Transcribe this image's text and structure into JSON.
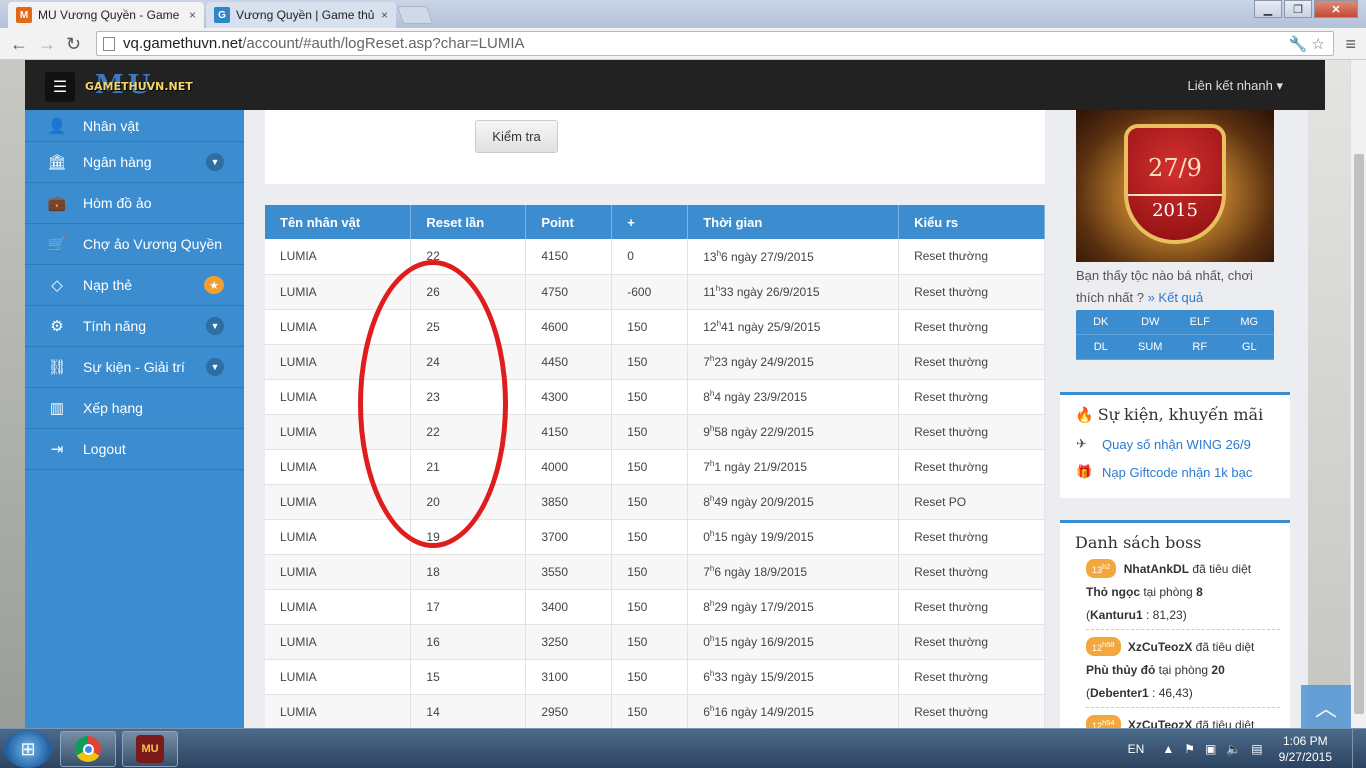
{
  "browser": {
    "tabs": [
      {
        "title": "MU Vương Quyền - Game",
        "favicon": "mu-favicon",
        "close": "×"
      },
      {
        "title": "Vương Quyền | Game thủ",
        "favicon": "g-favicon",
        "close": "×"
      }
    ],
    "url_host": "vq.gamethuvn.net",
    "url_path": "/account/#auth/logReset.asp?char=LUMIA"
  },
  "header": {
    "logo_mu": "MU",
    "logo_site": "GAMETHUVN.NET",
    "quick_link": "Liên kết nhanh"
  },
  "sidebar": {
    "items": [
      {
        "label": "Nhân vật",
        "icon": "user-icon"
      },
      {
        "label": "Ngân hàng",
        "icon": "bank-icon"
      },
      {
        "label": "Hòm đồ ảo",
        "icon": "briefcase-icon"
      },
      {
        "label": "Chợ ảo Vương Quyền",
        "icon": "cart-icon"
      },
      {
        "label": "Nạp thẻ",
        "icon": "diamond-icon"
      },
      {
        "label": "Tính năng",
        "icon": "gears-icon"
      },
      {
        "label": "Sự kiện - Giải trí",
        "icon": "link-icon"
      },
      {
        "label": "Xếp hạng",
        "icon": "bar-chart-icon"
      },
      {
        "label": "Logout",
        "icon": "logout-icon"
      }
    ]
  },
  "check_button": "Kiểm tra",
  "table": {
    "headers": [
      "Tên nhân vật",
      "Reset lần",
      "Point",
      "+",
      "Thời gian",
      "Kiểu rs"
    ],
    "rows": [
      {
        "name": "LUMIA",
        "reset": "22",
        "point": "4150",
        "plus": "0",
        "h": "13",
        "m": "6 ngày 27/9/2015",
        "type": "Reset thường"
      },
      {
        "name": "LUMIA",
        "reset": "26",
        "point": "4750",
        "plus": "-600",
        "h": "11",
        "m": "33 ngày 26/9/2015",
        "type": "Reset thường"
      },
      {
        "name": "LUMIA",
        "reset": "25",
        "point": "4600",
        "plus": "150",
        "h": "12",
        "m": "41 ngày 25/9/2015",
        "type": "Reset thường"
      },
      {
        "name": "LUMIA",
        "reset": "24",
        "point": "4450",
        "plus": "150",
        "h": "7",
        "m": "23 ngày 24/9/2015",
        "type": "Reset thường"
      },
      {
        "name": "LUMIA",
        "reset": "23",
        "point": "4300",
        "plus": "150",
        "h": "8",
        "m": "4 ngày 23/9/2015",
        "type": "Reset thường"
      },
      {
        "name": "LUMIA",
        "reset": "22",
        "point": "4150",
        "plus": "150",
        "h": "9",
        "m": "58 ngày 22/9/2015",
        "type": "Reset thường"
      },
      {
        "name": "LUMIA",
        "reset": "21",
        "point": "4000",
        "plus": "150",
        "h": "7",
        "m": "1 ngày 21/9/2015",
        "type": "Reset thường"
      },
      {
        "name": "LUMIA",
        "reset": "20",
        "point": "3850",
        "plus": "150",
        "h": "8",
        "m": "49 ngày 20/9/2015",
        "type": "Reset PO"
      },
      {
        "name": "LUMIA",
        "reset": "19",
        "point": "3700",
        "plus": "150",
        "h": "0",
        "m": "15 ngày 19/9/2015",
        "type": "Reset thường"
      },
      {
        "name": "LUMIA",
        "reset": "18",
        "point": "3550",
        "plus": "150",
        "h": "7",
        "m": "6 ngày 18/9/2015",
        "type": "Reset thường"
      },
      {
        "name": "LUMIA",
        "reset": "17",
        "point": "3400",
        "plus": "150",
        "h": "8",
        "m": "29 ngày 17/9/2015",
        "type": "Reset thường"
      },
      {
        "name": "LUMIA",
        "reset": "16",
        "point": "3250",
        "plus": "150",
        "h": "0",
        "m": "15 ngày 16/9/2015",
        "type": "Reset thường"
      },
      {
        "name": "LUMIA",
        "reset": "15",
        "point": "3100",
        "plus": "150",
        "h": "6",
        "m": "33 ngày 15/9/2015",
        "type": "Reset thường"
      },
      {
        "name": "LUMIA",
        "reset": "14",
        "point": "2950",
        "plus": "150",
        "h": "6",
        "m": "16 ngày 14/9/2015",
        "type": "Reset thường"
      }
    ]
  },
  "banner": {
    "date": "27/9",
    "year": "2015"
  },
  "vote": {
    "question": "Bạn thấy tộc nào bá nhất, chơi thích nhất ?",
    "link": "» Kết quả"
  },
  "classes": [
    "DK",
    "DW",
    "ELF",
    "MG",
    "DL",
    "SUM",
    "RF",
    "GL"
  ],
  "events": {
    "title": "Sự kiện, khuyến mãi",
    "items": [
      {
        "label": "Quay số nhận WING 26/9",
        "icon": "plane-icon"
      },
      {
        "label": "Nạp Giftcode nhận 1k bạc",
        "icon": "gift-icon"
      }
    ]
  },
  "boss": {
    "title": "Danh sách boss",
    "entries": [
      {
        "time_h": "13",
        "time_m": "h2",
        "killer": "NhatAnkDL",
        "verb": "đã tiêu diệt",
        "boss": "Thỏ ngọc",
        "room_label": "tại phòng",
        "room": "8",
        "map": "Kanturu1",
        "coords": ": 81,23)"
      },
      {
        "time_h": "12",
        "time_m": "h58",
        "killer": "XzCuTeozX",
        "verb": "đã tiêu diệt",
        "boss": "Phù thủy đỏ",
        "room_label": "tại phòng",
        "room": "20",
        "map": "Debenter1",
        "coords": ": 46,43)"
      },
      {
        "time_h": "12",
        "time_m": "h54",
        "killer": "XzCuTeozX",
        "verb": "đã tiêu diệt"
      }
    ]
  },
  "taskbar": {
    "lang": "EN",
    "time": "1:06 PM",
    "date": "9/27/2015",
    "mu_app_label": "MU"
  },
  "colors": {
    "accent": "#3c8dd0",
    "header": "#222222",
    "annotation": "#e01d1d"
  }
}
